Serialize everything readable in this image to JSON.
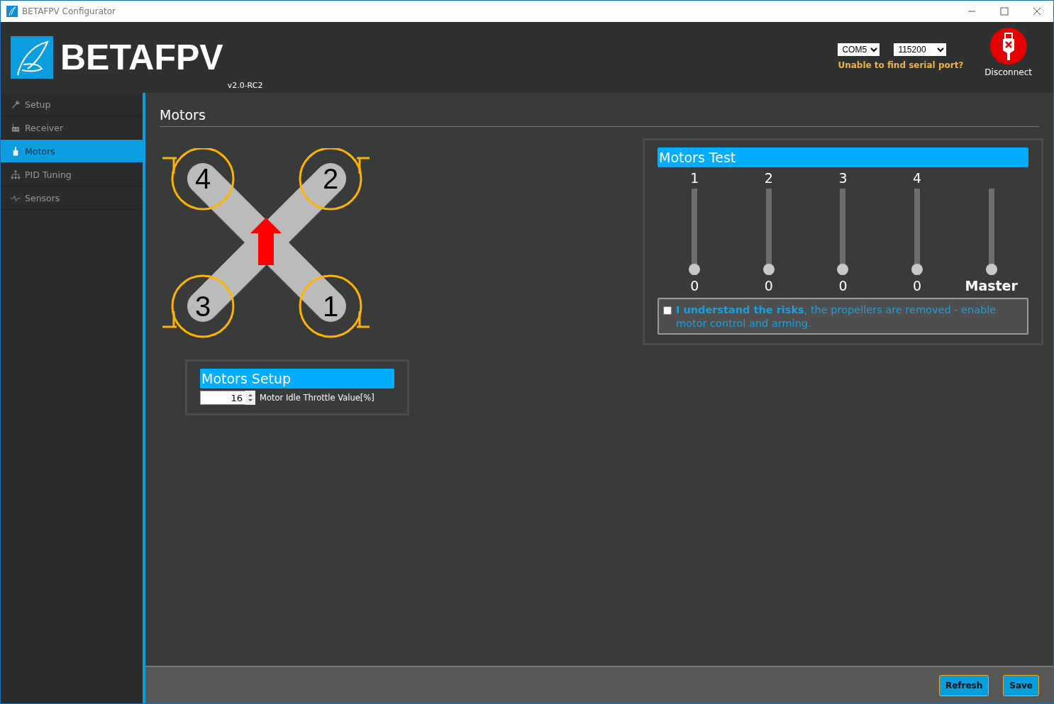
{
  "window": {
    "title": "BETAFPV Configurator"
  },
  "header": {
    "brand": "BETAFPV",
    "version": "v2.0-RC2",
    "port": "COM5",
    "baud": "115200",
    "port_hint": "Unable to find serial port?",
    "connect_label": "Disconnect"
  },
  "sidebar": {
    "items": [
      {
        "label": "Setup",
        "selected": false
      },
      {
        "label": "Receiver",
        "selected": false
      },
      {
        "label": "Motors",
        "selected": true
      },
      {
        "label": "PID Tuning",
        "selected": false
      },
      {
        "label": "Sensors",
        "selected": false
      }
    ]
  },
  "page": {
    "title": "Motors"
  },
  "drone": {
    "motors": [
      {
        "number": "4"
      },
      {
        "number": "2"
      },
      {
        "number": "3"
      },
      {
        "number": "1"
      }
    ]
  },
  "motors_setup": {
    "title": "Motors Setup",
    "idle_throttle": {
      "value": "16",
      "label": "Motor Idle Throttle Value[%]"
    }
  },
  "motors_test": {
    "title": "Motors Test",
    "sliders": [
      {
        "kind": "motor",
        "label": "1",
        "reading": "0",
        "level": 0
      },
      {
        "kind": "motor",
        "label": "2",
        "reading": "0",
        "level": 0
      },
      {
        "kind": "motor",
        "label": "3",
        "reading": "0",
        "level": 0
      },
      {
        "kind": "motor",
        "label": "4",
        "reading": "0",
        "level": 0
      },
      {
        "kind": "master",
        "reading": "Master",
        "level": 0
      }
    ],
    "risk_checkbox": {
      "checked": false,
      "text": "**I understand the risks**, the propellers are removed - enable motor control and arming."
    }
  },
  "footer": {
    "buttons": [
      "Refresh",
      "Save"
    ]
  }
}
